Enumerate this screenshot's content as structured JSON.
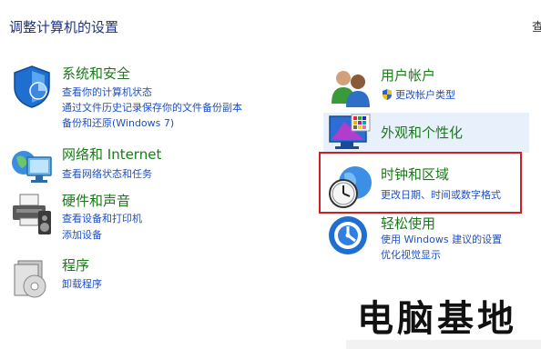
{
  "header": {
    "title": "调整计算机的设置",
    "view_by": "查"
  },
  "categories_left": [
    {
      "title": "系统和安全",
      "icon": "shield-icon",
      "links": [
        "查看你的计算机状态",
        "通过文件历史记录保存你的文件备份副本",
        "备份和还原(Windows 7)"
      ]
    },
    {
      "title": "网络和 Internet",
      "icon": "network-icon",
      "links": [
        "查看网络状态和任务"
      ]
    },
    {
      "title": "硬件和声音",
      "icon": "printer-icon",
      "links": [
        "查看设备和打印机",
        "添加设备"
      ]
    },
    {
      "title": "程序",
      "icon": "programs-icon",
      "links": [
        "卸载程序"
      ]
    }
  ],
  "categories_right": [
    {
      "title": "用户帐户",
      "icon": "users-icon",
      "links": [
        "更改帐户类型"
      ],
      "link_icon": "uac-shield-icon"
    },
    {
      "title": "外观和个性化",
      "icon": "appearance-icon",
      "links": []
    },
    {
      "title": "时钟和区域",
      "icon": "clock-globe-icon",
      "links": [
        "更改日期、时间或数字格式"
      ]
    },
    {
      "title": "轻松使用",
      "icon": "ease-of-access-icon",
      "links": [
        "使用 Windows 建议的设置",
        "优化视觉显示"
      ]
    }
  ],
  "watermark": "电脑基地",
  "colors": {
    "title_green": "#1a7a1a",
    "link_blue": "#1e50c8",
    "header_blue": "#1e3287",
    "selection_red": "#d01c24"
  }
}
